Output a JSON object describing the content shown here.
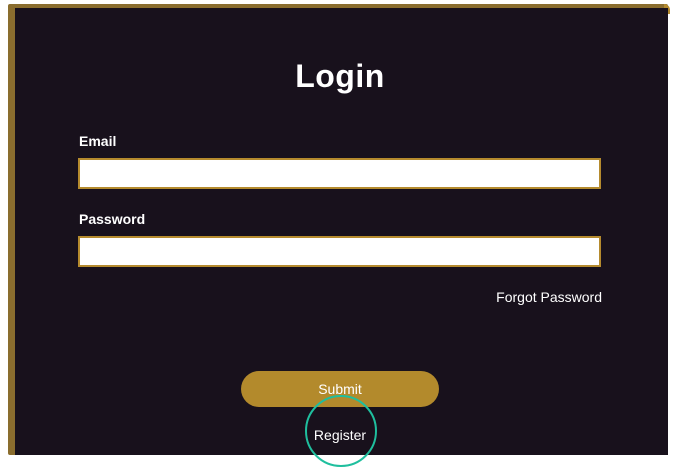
{
  "form": {
    "title": "Login",
    "email_label": "Email",
    "email_value": "",
    "password_label": "Password",
    "password_value": "",
    "forgot_label": "Forgot Password",
    "submit_label": "Submit",
    "register_label": "Register"
  },
  "colors": {
    "background": "#18111c",
    "accent": "#b38a2c",
    "highlight": "#1fbf9e"
  }
}
